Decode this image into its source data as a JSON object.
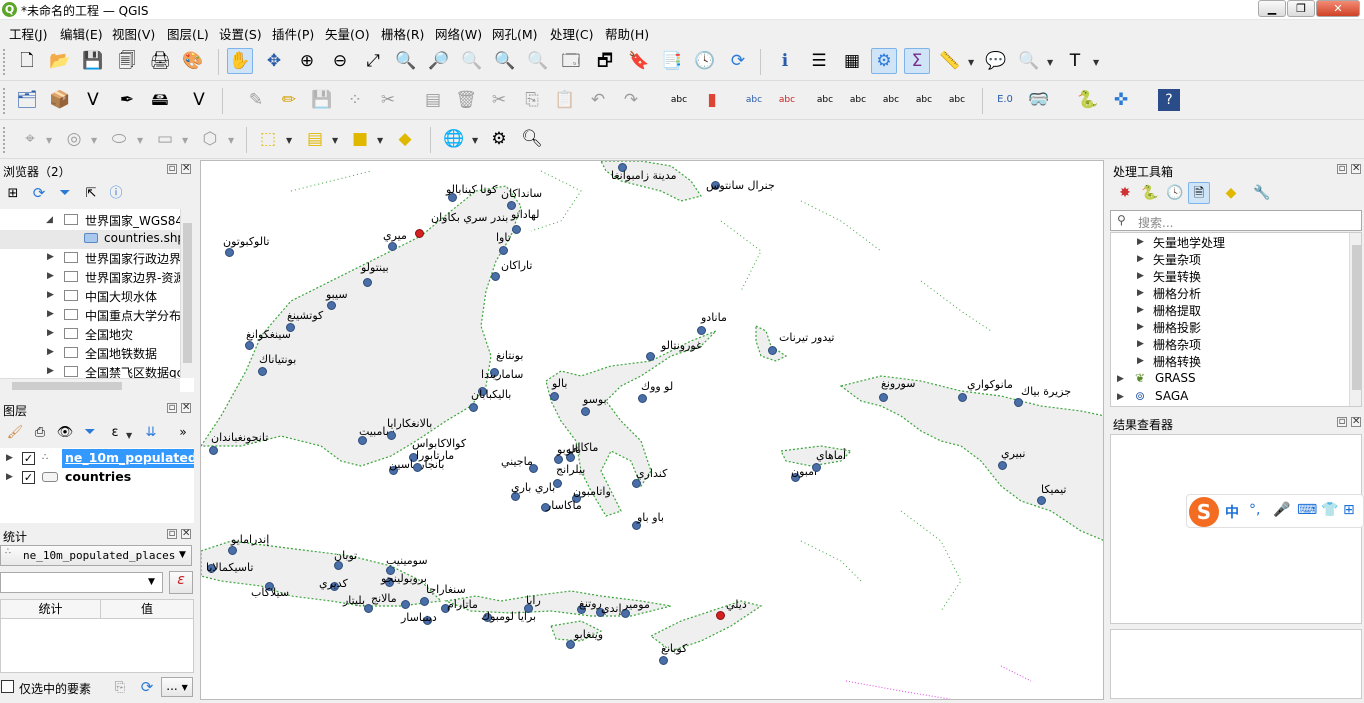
{
  "window": {
    "title": "*未命名的工程 — QGIS",
    "icon": "qgis-logo",
    "controls": [
      "minimize",
      "maximize",
      "close"
    ]
  },
  "menu": [
    "工程(J)",
    "编辑(E)",
    "视图(V)",
    "图层(L)",
    "设置(S)",
    "插件(P)",
    "矢量(O)",
    "栅格(R)",
    "网络(W)",
    "网孔(M)",
    "处理(C)",
    "帮助(H)"
  ],
  "browser": {
    "title": "浏览器（2）",
    "items": [
      {
        "label": "世界国家_WGS84",
        "expanded": true
      },
      {
        "label": "countries.shp",
        "child": true
      },
      {
        "label": "世界国家行政边界"
      },
      {
        "label": "世界国家边界-资源"
      },
      {
        "label": "中国大坝水体"
      },
      {
        "label": "中国重点大学分布"
      },
      {
        "label": "全国地灾"
      },
      {
        "label": "全国地铁数据"
      },
      {
        "label": "全国禁飞区数据qc"
      }
    ]
  },
  "layers": {
    "title": "图层",
    "items": [
      {
        "label": "ne_10m_populated",
        "checked": true,
        "selected": true
      },
      {
        "label": "countries",
        "checked": true
      }
    ]
  },
  "statistics": {
    "title": "统计",
    "layer": "ne_10m_populated_places",
    "col_stat": "统计",
    "col_value": "值",
    "selected_only": "仅选中的要素",
    "more_button": "..."
  },
  "toolbox": {
    "title": "处理工具箱",
    "search_placeholder": "搜索...",
    "items": [
      "矢量地学处理",
      "矢量杂项",
      "矢量转换",
      "栅格分析",
      "栅格提取",
      "栅格投影",
      "栅格杂项",
      "栅格转换"
    ],
    "providers": [
      "GRASS",
      "SAGA"
    ]
  },
  "results": {
    "title": "结果查看器"
  },
  "ime": {
    "logo": "S",
    "items": [
      "中",
      "°,",
      "🎤",
      "⌨",
      "👕",
      "⊞"
    ]
  },
  "colors": {
    "point": "#4a6ea8",
    "point_selected": "#d42020",
    "coast": "#3aa53a",
    "land": "#efefef",
    "selection": "#3399ff"
  },
  "map": {
    "places": [
      {
        "name": "مدينة زامبوانغا",
        "red": false
      },
      {
        "name": "جنرال سانتوس",
        "red": false
      },
      {
        "name": "كوتا كينابالو",
        "red": false
      },
      {
        "name": "سانداكان",
        "red": false
      },
      {
        "name": "بندر سري بكاوان",
        "red": true
      },
      {
        "name": "لهاداتو",
        "red": false
      },
      {
        "name": "ميري",
        "red": false
      },
      {
        "name": "تاوا",
        "red": false
      },
      {
        "name": "تالوكبوتون",
        "red": false
      },
      {
        "name": "بينتولو",
        "red": false
      },
      {
        "name": "تاراكان",
        "red": false
      },
      {
        "name": "سيبو",
        "red": false
      },
      {
        "name": "كوتشينغ",
        "red": false
      },
      {
        "name": "سينغكوانغ",
        "red": false
      },
      {
        "name": "بونتياناك",
        "red": false
      },
      {
        "name": "مانادو",
        "red": false
      },
      {
        "name": "غورونتالو",
        "red": false
      },
      {
        "name": "تيدور تيرنات",
        "red": false
      },
      {
        "name": "بونتانغ",
        "red": false
      },
      {
        "name": "ساماريندا",
        "red": false
      },
      {
        "name": "باليكبابان",
        "red": false
      },
      {
        "name": "بالو",
        "red": false
      },
      {
        "name": "بوسو",
        "red": false
      },
      {
        "name": "لو ووك",
        "red": false
      },
      {
        "name": "سورونغ",
        "red": false
      },
      {
        "name": "مانوكواري",
        "red": false
      },
      {
        "name": "جزيرة بياك",
        "red": false
      },
      {
        "name": "تانجونغباندان",
        "red": false
      },
      {
        "name": "سامبيت",
        "red": false
      },
      {
        "name": "بالانغكارايا",
        "red": false
      },
      {
        "name": "كوالاكابواس",
        "red": false
      },
      {
        "name": "بانجارماسين",
        "red": false
      },
      {
        "name": "مارتابورا",
        "red": false
      },
      {
        "name": "ماكالي",
        "red": false
      },
      {
        "name": "بالوبو",
        "red": false
      },
      {
        "name": "ماجيني",
        "red": false
      },
      {
        "name": "بيلرانج",
        "red": false
      },
      {
        "name": "باري باري",
        "red": false
      },
      {
        "name": "واتامبون",
        "red": false
      },
      {
        "name": "ماكاسار",
        "red": false
      },
      {
        "name": "كنداري",
        "red": false
      },
      {
        "name": "باو باو",
        "red": false
      },
      {
        "name": "أمبون",
        "red": false
      },
      {
        "name": "أماهاي",
        "red": false
      },
      {
        "name": "نبيري",
        "red": false
      },
      {
        "name": "تيميكا",
        "red": false
      },
      {
        "name": "إندرامايو",
        "red": false
      },
      {
        "name": "سومينيب",
        "red": false
      },
      {
        "name": "توبان",
        "red": false
      },
      {
        "name": "بروبولينجو",
        "red": false
      },
      {
        "name": "سنغاراجا",
        "red": false
      },
      {
        "name": "ماتارام",
        "red": false
      },
      {
        "name": "مالانج",
        "red": false
      },
      {
        "name": "بليتار",
        "red": false
      },
      {
        "name": "كديري",
        "red": false
      },
      {
        "name": "سيلاكاب",
        "red": false
      },
      {
        "name": "تاسيكمالايا",
        "red": false
      },
      {
        "name": "دينباسار",
        "red": false
      },
      {
        "name": "برايا لومبوك",
        "red": false
      },
      {
        "name": "رابا",
        "red": false
      },
      {
        "name": "روتنغ",
        "red": false
      },
      {
        "name": "إندي",
        "red": false
      },
      {
        "name": "مومير",
        "red": false
      },
      {
        "name": "ديلي",
        "red": true
      },
      {
        "name": "وينغابو",
        "red": false
      },
      {
        "name": "كوبانغ",
        "red": false
      }
    ]
  }
}
